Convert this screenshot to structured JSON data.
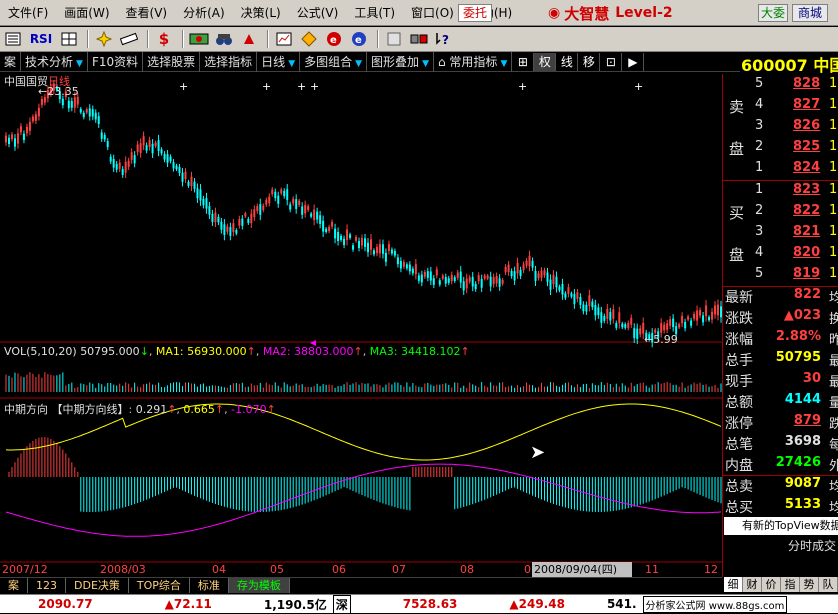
{
  "menubar": {
    "items": [
      "文件(F)",
      "画面(W)",
      "查看(V)",
      "分析(A)",
      "决策(L)",
      "公式(V)",
      "工具(T)",
      "窗口(O)",
      "帮助(H)"
    ],
    "weituo": "委托",
    "brand_name": "大智慧",
    "brand_level": "Level-2",
    "btn_dayu": "大委",
    "btn_shangcheng": "商城"
  },
  "toolbar": {
    "icons": [
      "list-icon",
      "rsi-icon",
      "grid-icon",
      "crosshair-icon",
      "ruler-icon",
      "dollar-icon",
      "cash-icon",
      "binoculars-icon",
      "alarm-icon",
      "chart-icon",
      "diamond-icon",
      "recycle-icon",
      "star-icon",
      "news-icon",
      "blocks-icon",
      "help-icon"
    ],
    "rsi_label": "RSI"
  },
  "funcbar": {
    "items": [
      "案",
      "技术分析",
      "F10资料",
      "选择股票",
      "选择指标",
      "日线",
      "多图组合",
      "图形叠加",
      "常用指标"
    ],
    "right_buttons": [
      "权",
      "线",
      "移"
    ]
  },
  "stock": {
    "code": "600007",
    "name": "中国国贸",
    "period": "日线",
    "high_label": "23.35",
    "low_label": "5.99"
  },
  "volume": {
    "label": "VOL(5,10,20)",
    "value": "50795.000",
    "ma1": "MA1: 56930.000",
    "ma2": "MA2: 38803.000",
    "ma3": "MA3: 34418.102"
  },
  "indicator": {
    "name": "中期方向",
    "line_label": "【中期方向线】",
    "v1": "0.291",
    "v2": "0.665",
    "v3": "-1.070"
  },
  "x_axis": [
    "2007/12",
    "2008/03",
    "04",
    "05",
    "06",
    "07",
    "08",
    "0",
    "11",
    "12"
  ],
  "date_tip": "2008/09/04(四)",
  "orderbook": {
    "sell_label_1": "卖",
    "sell_label_2": "盘",
    "buy_label_1": "买",
    "buy_label_2": "盘",
    "sell": [
      {
        "lvl": "5",
        "price": "828",
        "vol": "1"
      },
      {
        "lvl": "4",
        "price": "827",
        "vol": "1"
      },
      {
        "lvl": "3",
        "price": "826",
        "vol": "1"
      },
      {
        "lvl": "2",
        "price": "825",
        "vol": "1"
      },
      {
        "lvl": "1",
        "price": "824",
        "vol": "1"
      }
    ],
    "buy": [
      {
        "lvl": "1",
        "price": "823",
        "vol": "1"
      },
      {
        "lvl": "2",
        "price": "822",
        "vol": "1"
      },
      {
        "lvl": "3",
        "price": "821",
        "vol": "1"
      },
      {
        "lvl": "4",
        "price": "820",
        "vol": "1"
      },
      {
        "lvl": "5",
        "price": "819",
        "vol": "1"
      }
    ]
  },
  "stats": [
    {
      "label": "最新",
      "value": "822",
      "color": "#ff4040",
      "extra": "均"
    },
    {
      "label": "涨跌",
      "value": "▲023",
      "color": "#ff4040",
      "extra": "换"
    },
    {
      "label": "涨幅",
      "value": "2.88%",
      "color": "#ff4040",
      "extra": "昨"
    },
    {
      "label": "总手",
      "value": "50795",
      "color": "#ffff00",
      "extra": "最"
    },
    {
      "label": "现手",
      "value": "30",
      "color": "#ff4040",
      "extra": "最"
    },
    {
      "label": "总额",
      "value": "4144",
      "color": "#00ffff",
      "extra": "量"
    },
    {
      "label": "涨停",
      "value": "879",
      "color": "#ff4040",
      "extra": "跌"
    },
    {
      "label": "总笔",
      "value": "3698",
      "color": "#e0e0e0",
      "extra": "每"
    },
    {
      "label": "内盘",
      "value": "27426",
      "color": "#00ff00",
      "extra": "外"
    },
    {
      "label": "总卖",
      "value": "9087",
      "color": "#ffff00",
      "extra": "均"
    },
    {
      "label": "总买",
      "value": "5133",
      "color": "#ffff00",
      "extra": "均"
    }
  ],
  "notice": "有新的TopView数据",
  "timeshare": "分时成交",
  "bottom_tabs": [
    "案",
    "123",
    "DDE决策",
    "TOP综合",
    "标准",
    "存为模板"
  ],
  "right_tabs": [
    "细",
    "财",
    "价",
    "指",
    "势",
    "队"
  ],
  "statusbar": {
    "sh_index": "2090.77",
    "sh_change": "▲72.11",
    "sh_amount": "1,190.5亿",
    "sz_label": "深",
    "sz_index": "7528.63",
    "sz_change": "▲249.48",
    "sz_amount": "541.",
    "ad": "分析家公式网 www.88gs.com"
  },
  "colors": {
    "up": "#ff4040",
    "down": "#00ffff",
    "ma_yellow": "#ffff00",
    "ma_magenta": "#ff00ff"
  }
}
